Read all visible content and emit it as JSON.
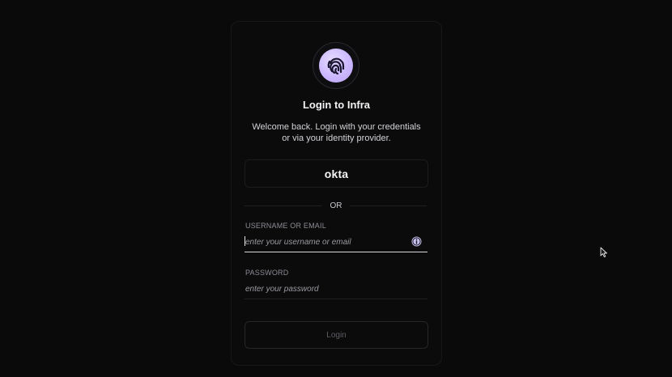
{
  "login": {
    "title": "Login to Infra",
    "subtitle_line1": "Welcome back. Login with your credentials",
    "subtitle_line2": "or via your identity provider.",
    "logo_icon": "fingerprint-icon",
    "provider_button_label": "okta",
    "divider_text": "OR",
    "username": {
      "label": "USERNAME OR EMAIL",
      "placeholder": "enter your username or email",
      "value": "",
      "icon": "info-icon"
    },
    "password": {
      "label": "PASSWORD",
      "placeholder": "enter your password",
      "value": ""
    },
    "submit_label": "Login"
  },
  "colors": {
    "background": "#0a0a0b",
    "logo_accent": "#cbb8ff",
    "info_icon": "#c7c3e8"
  },
  "cursor_icon": "mouse-pointer-icon"
}
